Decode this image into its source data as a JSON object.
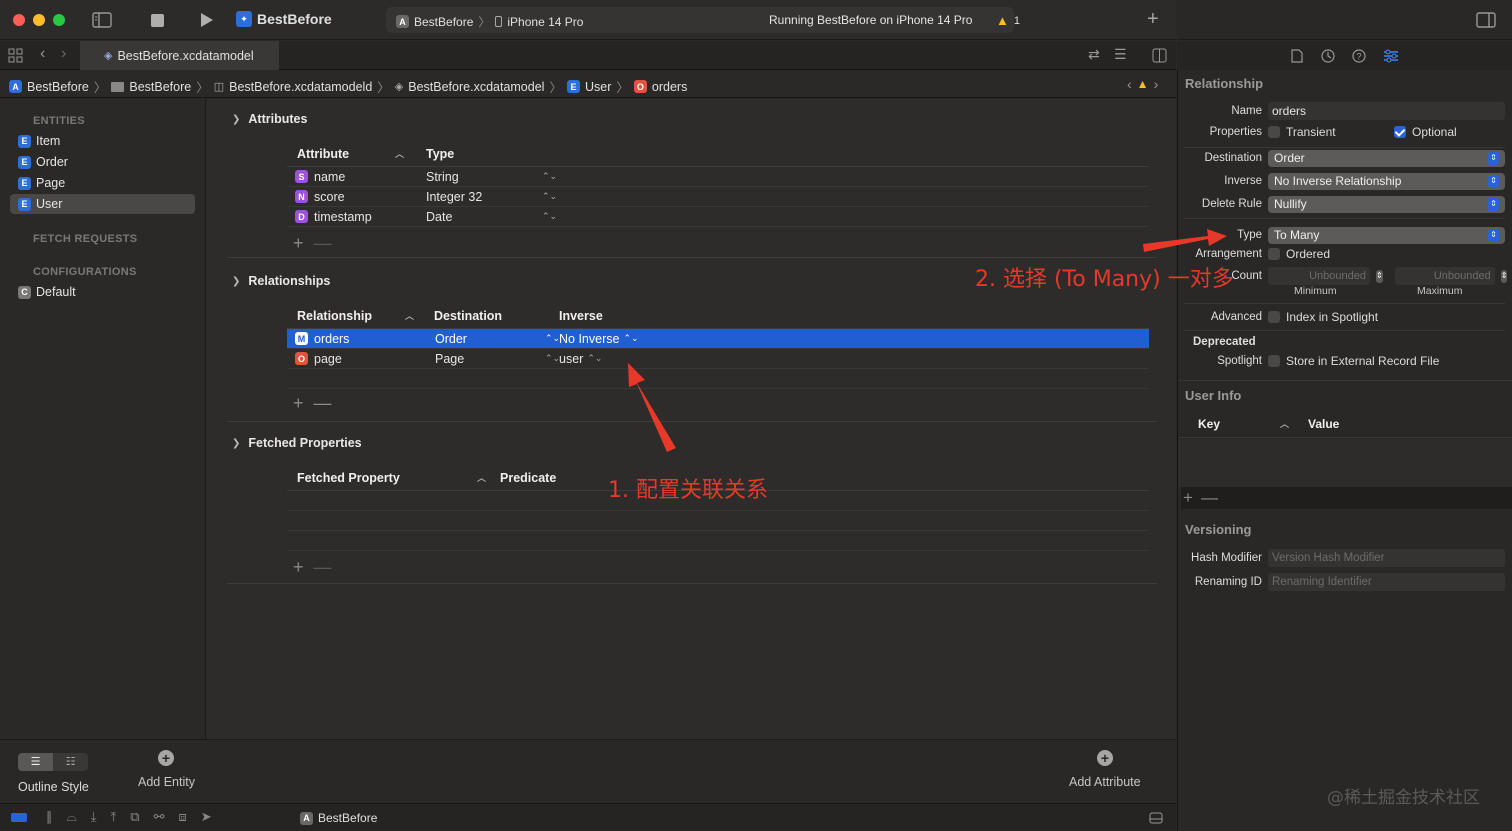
{
  "toolbar": {
    "scheme": "BestBefore",
    "destination_scheme": "BestBefore",
    "destination_device": "iPhone 14 Pro",
    "status": "Running BestBefore on iPhone 14 Pro",
    "warning_count": "1"
  },
  "tab": {
    "file": "BestBefore.xcdatamodel"
  },
  "breadcrumb": [
    "BestBefore",
    "BestBefore",
    "BestBefore.xcdatamodeld",
    "BestBefore.xcdatamodel",
    "User",
    "orders"
  ],
  "sidebar": {
    "entities_header": "ENTITIES",
    "entities": [
      {
        "letter": "E",
        "label": "Item"
      },
      {
        "letter": "E",
        "label": "Order"
      },
      {
        "letter": "E",
        "label": "Page"
      },
      {
        "letter": "E",
        "label": "User"
      }
    ],
    "fetch_header": "FETCH REQUESTS",
    "config_header": "CONFIGURATIONS",
    "configs": [
      {
        "letter": "C",
        "label": "Default"
      }
    ]
  },
  "attributes": {
    "title": "Attributes",
    "col_attribute": "Attribute",
    "col_type": "Type",
    "rows": [
      {
        "letter": "S",
        "name": "name",
        "type": "String"
      },
      {
        "letter": "N",
        "name": "score",
        "type": "Integer 32"
      },
      {
        "letter": "D",
        "name": "timestamp",
        "type": "Date"
      }
    ]
  },
  "relationships": {
    "title": "Relationships",
    "col_relationship": "Relationship",
    "col_destination": "Destination",
    "col_inverse": "Inverse",
    "rows": [
      {
        "letter": "M",
        "name": "orders",
        "destination": "Order",
        "inverse": "No Inverse"
      },
      {
        "letter": "O",
        "name": "page",
        "destination": "Page",
        "inverse": "user"
      }
    ]
  },
  "fetched": {
    "title": "Fetched Properties",
    "col_property": "Fetched Property",
    "col_predicate": "Predicate"
  },
  "bottom": {
    "outline_style": "Outline Style",
    "add_entity": "Add Entity",
    "add_attribute": "Add Attribute"
  },
  "status_bar": {
    "target": "BestBefore"
  },
  "inspector": {
    "relationship_header": "Relationship",
    "name_label": "Name",
    "name_value": "orders",
    "properties_label": "Properties",
    "transient_label": "Transient",
    "optional_label": "Optional",
    "destination_label": "Destination",
    "destination_value": "Order",
    "inverse_label": "Inverse",
    "inverse_value": "No Inverse Relationship",
    "delete_rule_label": "Delete Rule",
    "delete_rule_value": "Nullify",
    "type_label": "Type",
    "type_value": "To Many",
    "arrangement_label": "Arrangement",
    "ordered_label": "Ordered",
    "count_label": "Count",
    "min_placeholder": "Unbounded",
    "max_placeholder": "Unbounded",
    "minimum_label": "Minimum",
    "maximum_label": "Maximum",
    "advanced_label": "Advanced",
    "index_spotlight_label": "Index in Spotlight",
    "deprecated_label": "Deprecated",
    "spotlight_label": "Spotlight",
    "external_record_label": "Store in External Record File",
    "user_info_header": "User Info",
    "col_key": "Key",
    "col_value": "Value",
    "versioning_header": "Versioning",
    "hash_modifier_label": "Hash Modifier",
    "hash_modifier_placeholder": "Version Hash Modifier",
    "renaming_id_label": "Renaming ID",
    "renaming_id_placeholder": "Renaming Identifier"
  },
  "annotations": {
    "step1": "1. 配置关联关系",
    "step2": "2. 选择 (To Many) 一对多"
  },
  "watermark": "@稀土掘金技术社区",
  "colors": {
    "accent": "#2a63d9",
    "selection": "#1f5fd1",
    "annotation": "#e8382a"
  }
}
